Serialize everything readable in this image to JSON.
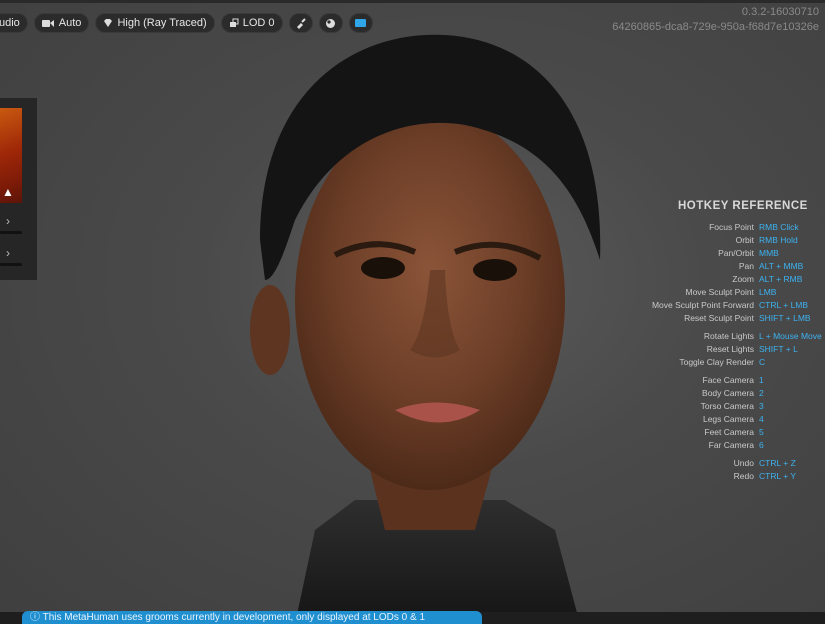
{
  "toolbar": {
    "audio_label": "udio",
    "auto_label": "Auto",
    "quality_label": "High (Ray Traced)",
    "lod_label": "LOD 0"
  },
  "version": {
    "line1": "0.3.2-16030710",
    "line2": "64260865-dca8-729e-950a-f68d7e10326e"
  },
  "hotkeys": {
    "title": "HOTKEY REFERENCE",
    "rows": [
      {
        "action": "Focus Point",
        "key": "RMB Click"
      },
      {
        "action": "Orbit",
        "key": "RMB Hold"
      },
      {
        "action": "Pan/Orbit",
        "key": "MMB"
      },
      {
        "action": "Pan",
        "key": "ALT + MMB"
      },
      {
        "action": "Zoom",
        "key": "ALT + RMB"
      },
      {
        "action": "Move Sculpt Point",
        "key": "LMB"
      },
      {
        "action": "Move Sculpt Point Forward",
        "key": "CTRL + LMB"
      },
      {
        "action": "Reset Sculpt Point",
        "key": "SHIFT + LMB"
      },
      {
        "action": "Rotate Lights",
        "key": "L + Mouse Move"
      },
      {
        "action": "Reset Lights",
        "key": "SHIFT + L"
      },
      {
        "action": "Toggle Clay Render",
        "key": "C"
      },
      {
        "action": "Face Camera",
        "key": "1"
      },
      {
        "action": "Body Camera",
        "key": "2"
      },
      {
        "action": "Torso Camera",
        "key": "3"
      },
      {
        "action": "Legs Camera",
        "key": "4"
      },
      {
        "action": "Feet Camera",
        "key": "5"
      },
      {
        "action": "Far Camera",
        "key": "6"
      },
      {
        "action": "Undo",
        "key": "CTRL + Z"
      },
      {
        "action": "Redo",
        "key": "CTRL + Y"
      }
    ]
  },
  "notice": "ⓘ This MetaHuman uses grooms currently in development, only displayed at LODs 0 & 1",
  "colors": {
    "accent": "#3db2f0",
    "notice_bg": "#1f8fd0"
  },
  "icons": [
    "camera-icon",
    "diamond-icon",
    "lod-icon",
    "brush-icon",
    "sphere-icon",
    "viewport-icon",
    "chevron-right-icon",
    "cursor-icon"
  ]
}
